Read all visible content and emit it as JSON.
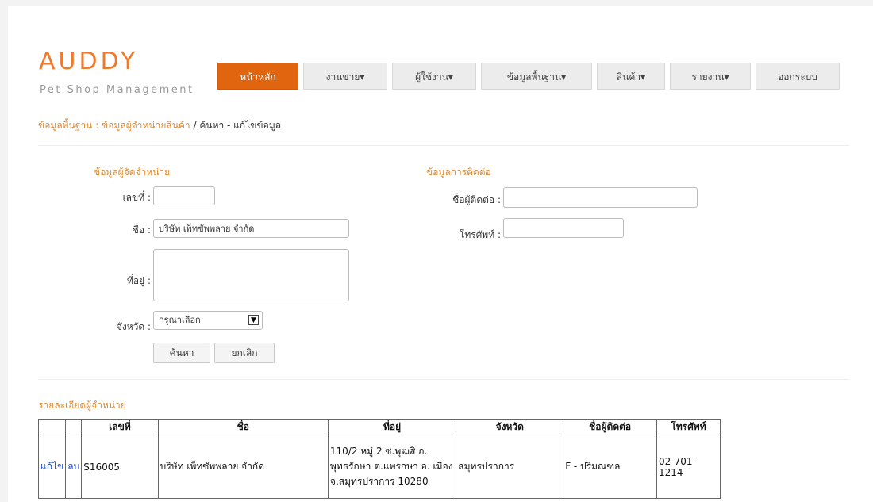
{
  "brand": {
    "title": "AUDDY",
    "subtitle": "Pet Shop Management"
  },
  "nav": [
    {
      "label": "หน้าหลัก",
      "active": true
    },
    {
      "label": "งานขาย▾"
    },
    {
      "label": "ผู้ใช้งาน▾"
    },
    {
      "label": "ข้อมูลพื้นฐาน▾"
    },
    {
      "label": "สินค้า▾"
    },
    {
      "label": "รายงาน▾"
    },
    {
      "label": "ออกระบบ"
    }
  ],
  "breadcrumb": {
    "part1": "ข้อมูลพื้นฐาน : ข้อมูลผู้จำหน่ายสินค้า",
    "sep": " / ",
    "part2": "ค้นหา - แก้ไขข้อมูล"
  },
  "supplier_section": {
    "title": "ข้อมูลผู้จัดจำหน่าย",
    "id_label": "เลขที่ :",
    "id_value": "",
    "name_label": "ชื่อ :",
    "name_value": "บริษัท เพ็ทซัพพลาย จำกัด",
    "address_label": "ที่อยู่ :",
    "address_value": "",
    "province_label": "จังหวัด :",
    "province_value": "กรุณาเลือก",
    "search_button": "ค้นหา",
    "cancel_button": "ยกเลิก"
  },
  "contact_section": {
    "title": "ข้อมูลการติดต่อ",
    "contact_label": "ชื่อผู้ติดต่อ :",
    "contact_value": "",
    "phone_label": "โทรศัพท์ :",
    "phone_value": ""
  },
  "results": {
    "title": "รายละเอียดผู้จำหน่าย",
    "columns": [
      "",
      "",
      "เลขที่",
      "ชื่อ",
      "ที่อยู่",
      "จังหวัด",
      "ชื่อผู้ติดต่อ",
      "โทรศัพท์"
    ],
    "rows": [
      {
        "edit": "แก้ไข",
        "delete": "ลบ",
        "id": "S16005",
        "name": "บริษัท เพ็ทซัพพลาย จำกัด",
        "address": "110/2 หมู่ 2 ซ.พุฒสิ ถ. พุทธรักษา ต.แพรกษา อ. เมือง จ.สมุทรปราการ 10280",
        "province": "สมุทรปราการ",
        "contact": "F - ปริมณฑล",
        "phone": "02-701-1214"
      }
    ]
  },
  "colors": {
    "brand_orange": "#f07a2a",
    "nav_active": "#e1640e",
    "section_orange": "#e08a2e",
    "link_blue": "#1a4fd0"
  }
}
